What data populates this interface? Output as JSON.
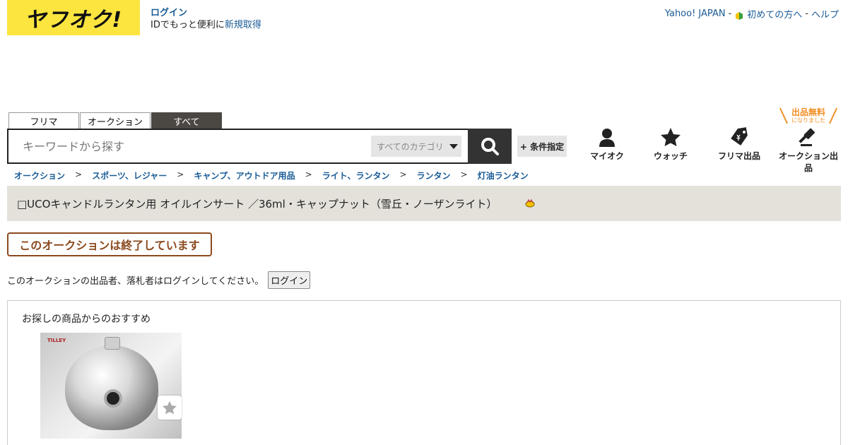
{
  "header": {
    "logo_text": "ヤフオク!",
    "login_label": "ログイン",
    "login_sub": "IDでもっと便利に",
    "signup_label": "新規取得",
    "top_links": {
      "yahoo_japan": "Yahoo! JAPAN",
      "first_time": "初めての方へ",
      "help": "ヘルプ",
      "separator": "-"
    }
  },
  "search": {
    "tabs": [
      {
        "label": "フリマ",
        "active": false
      },
      {
        "label": "オークション",
        "active": false
      },
      {
        "label": "すべて",
        "active": true
      }
    ],
    "placeholder": "キーワードから探す",
    "category_label": "すべてのカテゴリ",
    "condition_label": "+ 条件指定"
  },
  "nav": {
    "my_auction": "マイオク",
    "watch": "ウォッチ",
    "flea_listing": "フリマ出品",
    "auction_listing": "オークション出品",
    "free_badge_main": "出品無料",
    "free_badge_sub": "になりました"
  },
  "breadcrumb": [
    "オークション",
    "スポーツ、レジャー",
    "キャンプ、アウトドア用品",
    "ライト、ランタン",
    "ランタン",
    "灯油ランタン"
  ],
  "breadcrumb_sep": ">",
  "item": {
    "title": "□UCOキャンドルランタン用 オイルインサート ／36ml・キャップナット（雪丘・ノーザンライト）",
    "ended_label": "このオークションは終了しています",
    "login_message": "このオークションの出品者、落札者はログインしてください。",
    "login_button": "ログイン"
  },
  "recommend": {
    "title": "お探しの商品からのおすすめ",
    "item_brand": "TILLEY"
  },
  "colors": {
    "logo_bg": "#fde53f",
    "link": "#1a5b96",
    "title_bar_bg": "#e3e1da",
    "ended_border": "#8b4a1f",
    "free_badge": "#f08f24",
    "search_btn": "#333333"
  },
  "icons": {
    "my_auction": "person-icon",
    "watch": "star-icon",
    "flea_listing": "price-tag-icon",
    "auction_listing": "gavel-icon",
    "search": "search-icon",
    "first_time": "beginner-leaf-icon"
  }
}
